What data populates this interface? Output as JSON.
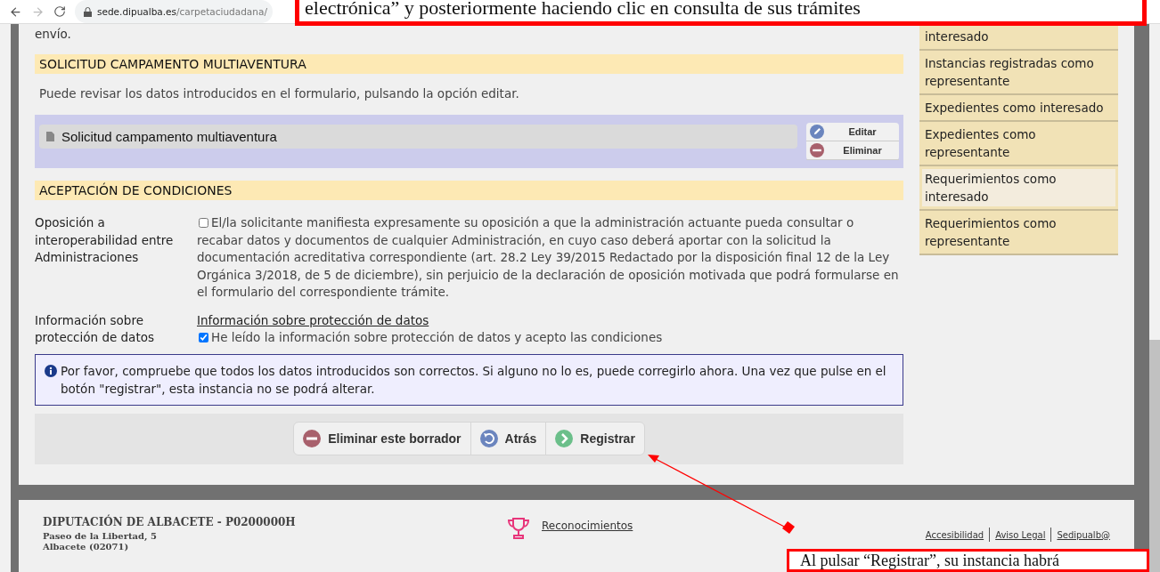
{
  "browser": {
    "url_host": "sede.dipualba.es",
    "url_path": "/carpetaciudadana/"
  },
  "intro_tail": "envío.",
  "form_section": {
    "title": "SOLICITUD CAMPAMENTO MULTIAVENTURA",
    "hint": "Puede revisar los datos introducidos en el formulario, pulsando la opción editar.",
    "document": "Solicitud campamento multiaventura",
    "actions": [
      {
        "kind": "edit",
        "label": "Editar"
      },
      {
        "kind": "delete",
        "label": "Eliminar"
      }
    ]
  },
  "conditions": {
    "title": "ACEPTACIÓN DE CONDICIONES",
    "rows": [
      {
        "label": "Oposición a interoperabilidad entre Administraciones",
        "link": null,
        "checked": false,
        "text": "El/la solicitante manifiesta expresamente su oposición a que la administración actuante pueda consultar o recabar datos y documentos de cualquier Administración, en cuyo caso deberá aportar con la solicitud la documentación acreditativa correspondiente (art. 28.2 Ley 39/2015 Redactado por la disposición final 12 de la Ley Orgánica 3/2018, de 5 de diciembre), sin perjuicio de la declaración de oposición motivada que podrá formularse en el formulario del correspondiente trámite."
      },
      {
        "label": "Información sobre protección de datos",
        "link": "Información sobre protección de datos",
        "checked": true,
        "text": "He leído la información sobre protección de datos y acepto las condiciones"
      }
    ]
  },
  "notice": "Por favor, compruebe que todos los datos introducidos son correctos. Si alguno no lo es, puede corregirlo ahora. Una vez que pulse en el botón \"registrar\", esta instancia no se podrá alterar.",
  "buttons": [
    {
      "kind": "delete",
      "label": "Eliminar este borrador"
    },
    {
      "kind": "back",
      "label": "Atrás"
    },
    {
      "kind": "next",
      "label": "Registrar"
    }
  ],
  "sidebar": {
    "items": [
      {
        "label": "interesado",
        "selected": false
      },
      {
        "label": "Instancias registradas como representante",
        "selected": false
      },
      {
        "label": "Expedientes como interesado",
        "selected": false
      },
      {
        "label": "Expedientes como representante",
        "selected": false
      },
      {
        "label": "Requerimientos como interesado",
        "selected": true
      },
      {
        "label": "Requerimientos como representante",
        "selected": false
      }
    ]
  },
  "footer": {
    "org": "DIPUTACIÓN DE ALBACETE - P0200000H",
    "address": [
      "Paseo de la Libertad, 5",
      "Albacete (02071)"
    ],
    "awards": "Reconocimientos",
    "links": [
      "Accesibilidad",
      "Aviso Legal",
      "Sedipualb@"
    ]
  },
  "annotations": {
    "top": "electrónica” y posteriormente haciendo clic en consulta de sus trámites",
    "bottom": "Al pulsar “Registrar”, su instancia habrá"
  }
}
